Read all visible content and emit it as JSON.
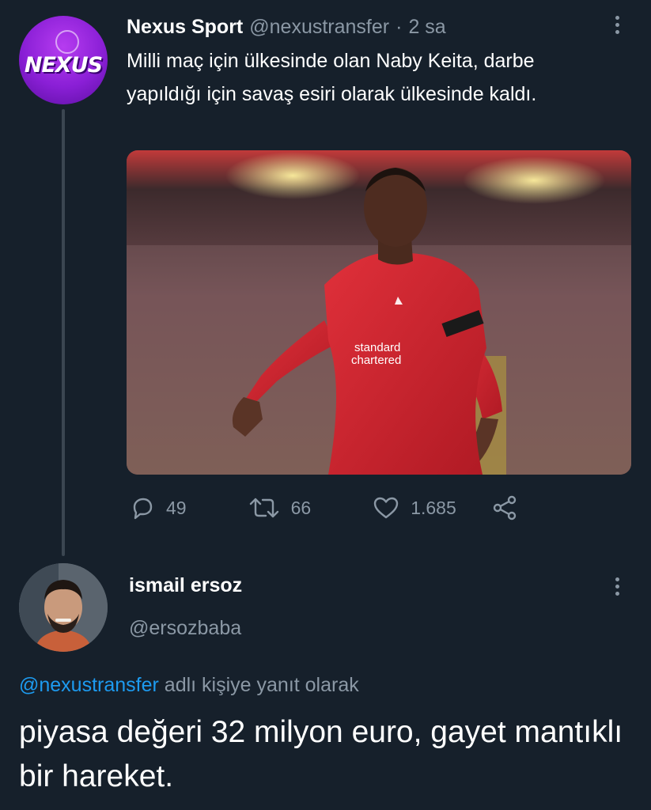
{
  "tweet": {
    "author_name": "Nexus Sport",
    "author_handle": "@nexustransfer",
    "separator": "·",
    "time": "2 sa",
    "avatar_logo_text": "NEXUS",
    "text": "Milli maç için ülkesinde olan Naby Keita, darbe yapıldığı için savaş esiri olarak ülkesinde kaldı.",
    "media_icon": "photo-football-player",
    "stats": {
      "replies": "49",
      "retweets": "66",
      "likes": "1.685"
    }
  },
  "reply": {
    "author_name": "ismail ersoz",
    "author_handle": "@ersozbaba",
    "replying_mention": "@nexustransfer",
    "replying_suffix": "adlı kişiye yanıt olarak",
    "text": "piyasa değeri 32 milyon euro, gayet mantıklı bir hareket."
  },
  "colors": {
    "background": "#16202b",
    "secondary_text": "#8b98a5",
    "link": "#1d9bf0",
    "jersey_red": "#d3242f"
  }
}
